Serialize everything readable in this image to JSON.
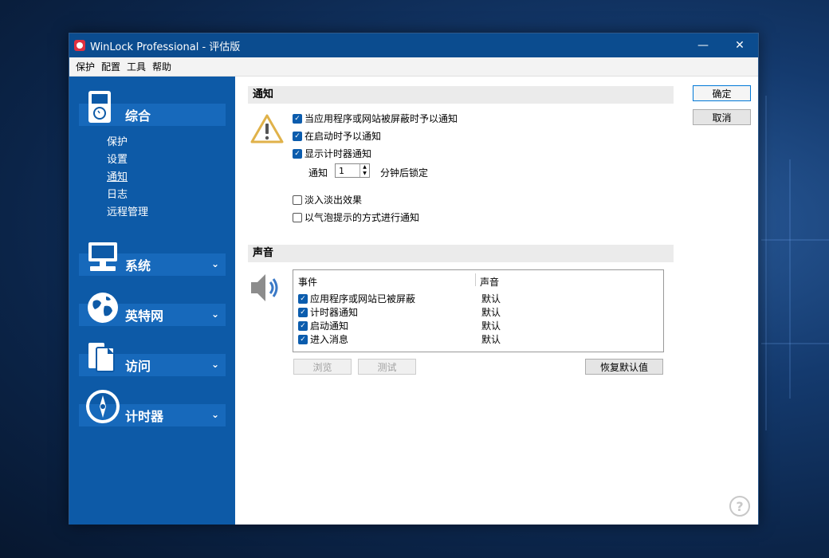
{
  "window": {
    "title": "WinLock Professional - 评估版"
  },
  "menu": [
    "保护",
    "配置",
    "工具",
    "帮助"
  ],
  "sidebar": {
    "sections": [
      {
        "label": "综合",
        "sub": [
          "保护",
          "设置",
          "通知",
          "日志",
          "远程管理"
        ],
        "active_sub": "通知"
      },
      {
        "label": "系统"
      },
      {
        "label": "英特网"
      },
      {
        "label": "访问"
      },
      {
        "label": "计时器"
      }
    ]
  },
  "notify": {
    "header": "通知",
    "cb1": "当应用程序或网站被屏蔽时予以通知",
    "cb2": "在启动时予以通知",
    "cb3": "显示计时器通知",
    "spin_prefix": "通知",
    "spin_value": "1",
    "spin_suffix": "分钟后锁定",
    "cb4": "淡入淡出效果",
    "cb5": "以气泡提示的方式进行通知"
  },
  "sound": {
    "header": "声音",
    "col_event": "事件",
    "col_sound": "声音",
    "rows": [
      {
        "event": "应用程序或网站已被屏蔽",
        "sound": "默认"
      },
      {
        "event": "计时器通知",
        "sound": "默认"
      },
      {
        "event": "启动通知",
        "sound": "默认"
      },
      {
        "event": "进入消息",
        "sound": "默认"
      }
    ],
    "browse": "浏览",
    "test": "测试",
    "restore": "恢复默认值"
  },
  "buttons": {
    "ok": "确定",
    "cancel": "取消"
  },
  "colors": {
    "sidebar": "#0d5aa7",
    "titlebar": "#0b4c8f",
    "accent": "#0b5cad"
  }
}
